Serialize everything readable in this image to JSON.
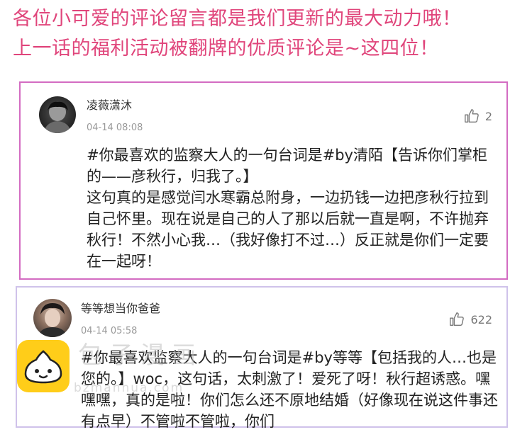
{
  "headline": {
    "line1": "各位小可爱的评论留言都是我们更新的最大动力哦！",
    "line2": "上一话的福利活动被翻牌的优质评论是~这四位！"
  },
  "comments": [
    {
      "username": "凌薇潇沐",
      "timestamp": "04-14 08:08",
      "likes": "2",
      "text": "#你最喜欢的监察大人的一句台词是#by清陌【告诉你们掌柜的——彦秋行，归我了。】\n这句真的是感觉闫水寒霸总附身，一边扔钱一边把彦秋行拉到自己怀里。现在说是自己的人了那以后就一直是啊，不许抛弃秋行！不然小心我…（我好像打不过…）反正就是你们一定要在一起呀！"
    },
    {
      "username": "等等想当你爸爸",
      "timestamp": "04-14 05:58",
      "likes": "622",
      "text": "#你最喜欢监察大人的一句台词是#by等等【包括我的人…也是您的。】woc，这句话，太刺激了！爱死了呀！秋行超诱惑。嘿嘿嘿，真的是啦！你们怎么还不原地结婚（好像现在说这件事还有点早）不管啦不管啦，你们"
    }
  ],
  "watermark": {
    "title": "包子漫画",
    "domain": "bzmanhua.com"
  },
  "colors": {
    "headline": "#e0457b",
    "card1_border": "#d36cc2",
    "card2_border": "#cfc2ea",
    "app_icon": "#ffcd19"
  },
  "icons": {
    "like": "thumbs-up-icon",
    "app": "bun-logo-icon"
  }
}
